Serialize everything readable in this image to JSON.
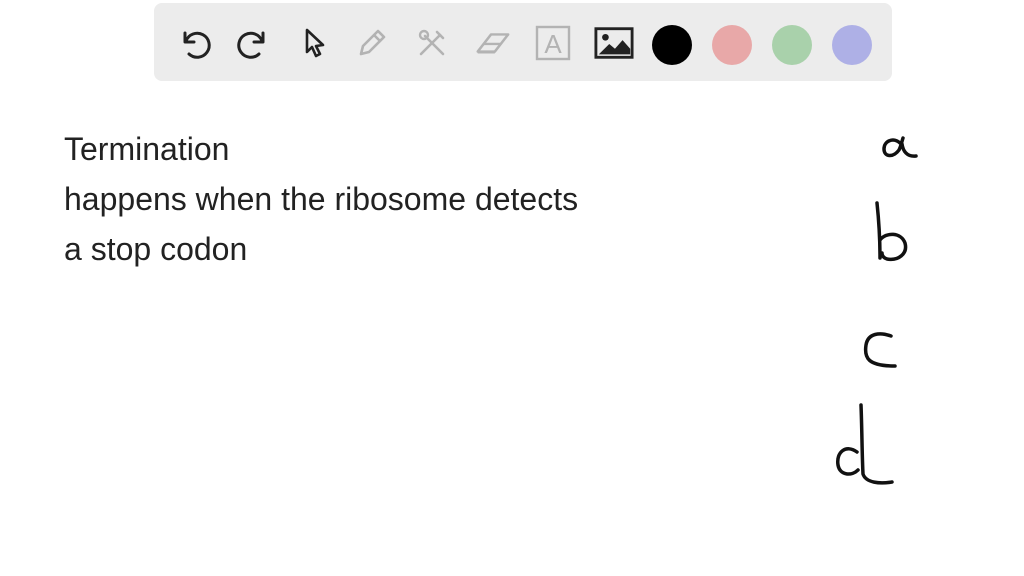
{
  "toolbar": {
    "tools": [
      {
        "name": "undo",
        "icon": "undo-icon",
        "enabled": true
      },
      {
        "name": "redo",
        "icon": "redo-icon",
        "enabled": true
      },
      {
        "name": "select",
        "icon": "pointer-icon",
        "enabled": true
      },
      {
        "name": "pen",
        "icon": "pencil-icon",
        "enabled": false
      },
      {
        "name": "tools",
        "icon": "tools-icon",
        "enabled": false
      },
      {
        "name": "eraser",
        "icon": "eraser-icon",
        "enabled": false
      },
      {
        "name": "text",
        "icon": "text-box-icon",
        "label": "A",
        "enabled": false
      },
      {
        "name": "image",
        "icon": "image-icon",
        "enabled": true
      }
    ],
    "colors": [
      "#000000",
      "#e8a8a8",
      "#a9d1ab",
      "#aeb0e6"
    ],
    "selected_color": "#000000",
    "enabled_color": "#222222",
    "disabled_color": "#b3b3b3"
  },
  "note": {
    "lines": [
      "Termination",
      "happens when the ribosome detects",
      "a stop codon"
    ]
  },
  "handwriting": {
    "options": [
      "a",
      "b",
      "c",
      "d"
    ]
  }
}
